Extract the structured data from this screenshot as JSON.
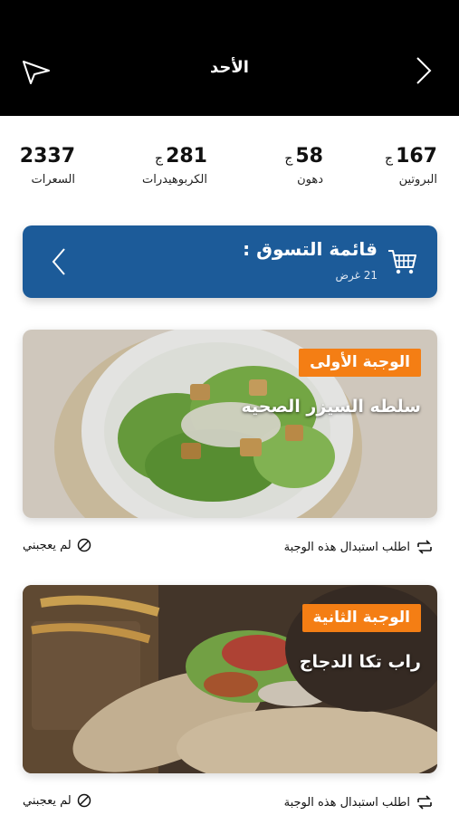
{
  "header": {
    "title": "الأحد",
    "background": "#000000",
    "left_icon": "paper-plane-icon",
    "right_icon": "chevron-right-icon"
  },
  "macros": [
    {
      "value": "167",
      "unit": "ج",
      "label": "البروتين"
    },
    {
      "value": "58",
      "unit": "ج",
      "label": "دهون"
    },
    {
      "value": "281",
      "unit": "ج",
      "label": "الكربوهيدرات"
    },
    {
      "value": "2337",
      "unit": "",
      "label": "السعرات"
    }
  ],
  "shopping": {
    "title": "قائمة التسوق :",
    "count": "21 غرض",
    "icon": "cart-icon",
    "color": "#1c5b99"
  },
  "meals": [
    {
      "badge": "الوجبة الأولى",
      "name": "سلطه السيزر الصحيه",
      "swap_label": "اطلب استبدال هذه الوجبة",
      "dislike_label": "لم يعجبني"
    },
    {
      "badge": "الوجبة الثانية",
      "name": "راب تكا الدجاج",
      "swap_label": "اطلب استبدال هذه الوجبة",
      "dislike_label": "لم يعجبني"
    }
  ],
  "accent": "#f47e14"
}
